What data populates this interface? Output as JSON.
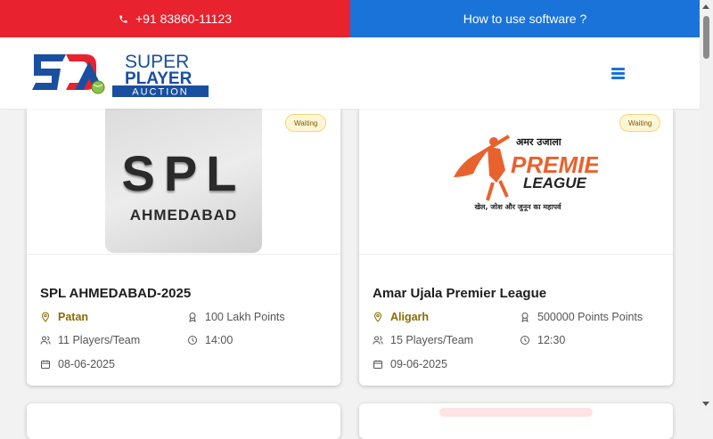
{
  "topbar": {
    "phone": "+91 83860-11123",
    "howto": "How to use software ?"
  },
  "header": {
    "logo_line1": "SUPER",
    "logo_line2": "PLAYER",
    "logo_line3": "AUCTION"
  },
  "tournaments": [
    {
      "status": "Waiting",
      "image_text_1": "SPL",
      "image_text_2": "AHMEDABAD",
      "title": "SPL AHMEDABAD-2025",
      "location": "Patan",
      "points": "100 Lakh Points",
      "players": "11 Players/Team",
      "time": "14:00",
      "date": "08-06-2025"
    },
    {
      "status": "Waiting",
      "image_text_1": "अमर उजाला",
      "image_text_2": "PREMIER",
      "image_text_3": "LEAGUE",
      "image_text_4": "खेल, जोश और जुनून का महापर्व",
      "title": "Amar Ujala Premier League",
      "location": "Aligarh",
      "points": "500000 Points Points",
      "players": "15 Players/Team",
      "time": "12:30",
      "date": "09-06-2025"
    }
  ],
  "colors": {
    "phone_bar": "#e8222e",
    "howto_bar": "#1a73d9",
    "location_text": "#8a6b00",
    "badge_bg": "#fff6d6"
  }
}
